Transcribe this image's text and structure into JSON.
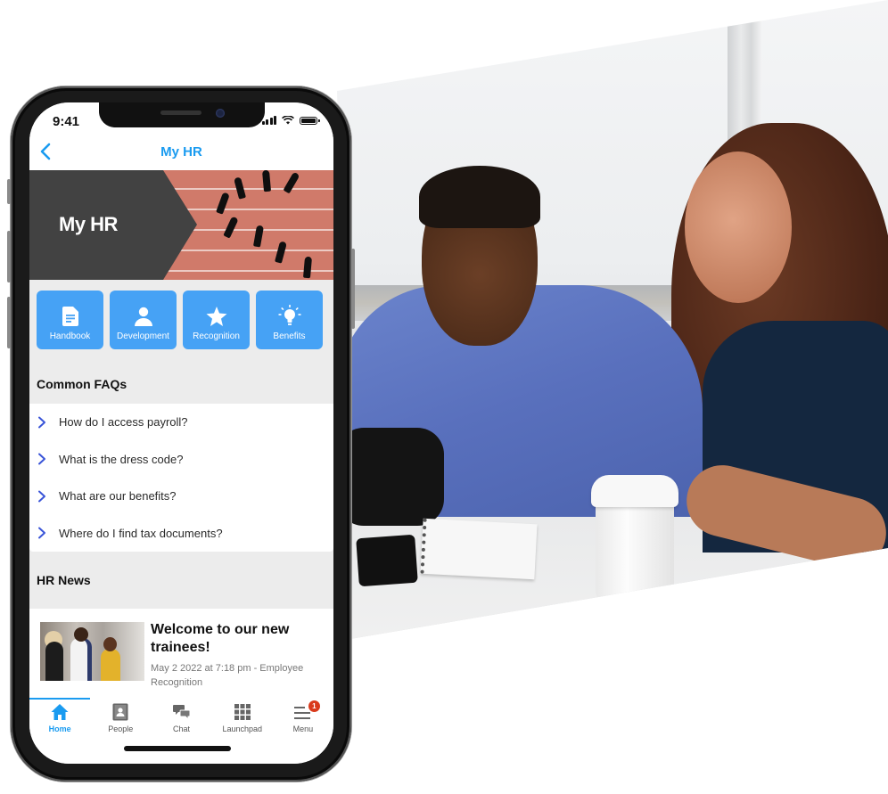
{
  "status_bar": {
    "time": "9:41"
  },
  "nav": {
    "title": "My HR",
    "back_icon": "chevron-left-icon"
  },
  "hero": {
    "title": "My HR"
  },
  "tiles": [
    {
      "label": "Handbook",
      "icon": "document-icon"
    },
    {
      "label": "Development",
      "icon": "person-icon"
    },
    {
      "label": "Recognition",
      "icon": "star-icon"
    },
    {
      "label": "Benefits",
      "icon": "lightbulb-icon"
    }
  ],
  "faqs": {
    "heading": "Common FAQs",
    "items": [
      "How do I access payroll?",
      "What is the dress code?",
      "What are our benefits?",
      "Where do I find tax documents?"
    ]
  },
  "news": {
    "heading": "HR News",
    "items": [
      {
        "title": "Welcome to our new trainees!",
        "meta": "May 2 2022 at 7:18 pm - Employee Recognition"
      }
    ]
  },
  "tab_bar": {
    "tabs": [
      {
        "label": "Home",
        "icon": "home-icon",
        "active": true
      },
      {
        "label": "People",
        "icon": "contacts-icon"
      },
      {
        "label": "Chat",
        "icon": "chat-icon"
      },
      {
        "label": "Launchpad",
        "icon": "grid-icon"
      },
      {
        "label": "Menu",
        "icon": "menu-icon",
        "badge": "1"
      }
    ]
  },
  "colors": {
    "accent": "#1a9bf0",
    "tile": "#46a2f5",
    "hero_dark": "#424242",
    "badge": "#d93a1c",
    "faq_chevron": "#3a55d8"
  }
}
